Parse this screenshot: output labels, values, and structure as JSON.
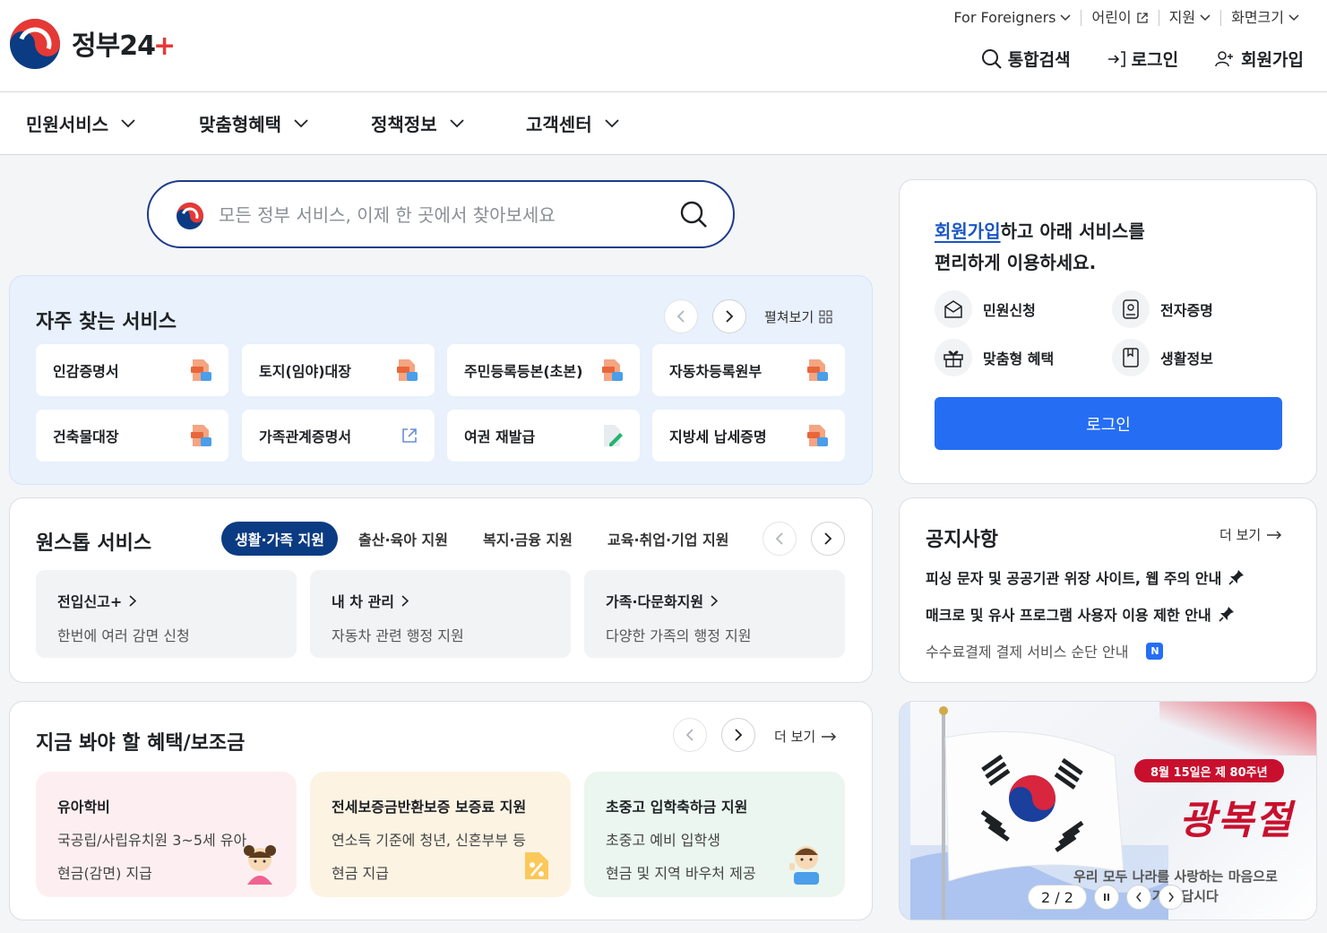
{
  "header": {
    "logo_text": "정부24",
    "utility": [
      {
        "label": "For Foreigners"
      },
      {
        "label": "어린이"
      },
      {
        "label": "지원"
      },
      {
        "label": "화면크기"
      }
    ],
    "actions": {
      "search": "통합검색",
      "login": "로그인",
      "signup": "회원가입"
    }
  },
  "gnb": [
    {
      "label": "민원서비스"
    },
    {
      "label": "맞춤형혜택"
    },
    {
      "label": "정책정보"
    },
    {
      "label": "고객센터"
    }
  ],
  "search": {
    "placeholder": "모든 정부 서비스, 이제 한 곳에서 찾아보세요"
  },
  "frequent": {
    "title": "자주 찾는 서비스",
    "expand": "펼쳐보기",
    "items": [
      {
        "label": "인감증명서",
        "icon": "pdf-doc-icon"
      },
      {
        "label": "토지(임야)대장",
        "icon": "pdf-doc-icon"
      },
      {
        "label": "주민등록등본(초본)",
        "icon": "pdf-doc-icon"
      },
      {
        "label": "자동차등록원부",
        "icon": "pdf-doc-icon"
      },
      {
        "label": "건축물대장",
        "icon": "pdf-doc-icon"
      },
      {
        "label": "가족관계증명서",
        "icon": "external-link-icon"
      },
      {
        "label": "여권 재발급",
        "icon": "edit-doc-icon"
      },
      {
        "label": "지방세 납세증명",
        "icon": "pdf-doc-icon"
      }
    ]
  },
  "onestop": {
    "title": "원스톱 서비스",
    "tabs": [
      "생활·가족 지원",
      "출산·육아 지원",
      "복지·금융 지원",
      "교육·취업·기업 지원"
    ],
    "cards": [
      {
        "title": "전입신고+",
        "sub": "한번에 여러 감면 신청"
      },
      {
        "title": "내 차 관리",
        "sub": "자동차 관련 행정 지원"
      },
      {
        "title": "가족·다문화지원",
        "sub": "다양한 가족의 행정 지원"
      }
    ]
  },
  "benefits": {
    "title": "지금 봐야 할 혜택/보조금",
    "more": "더 보기",
    "cards": [
      {
        "title": "유아학비",
        "l1": "국공립/사립유치원 3~5세 유아",
        "l2": "현금(감면) 지급",
        "bg": "#fdeff1"
      },
      {
        "title": "전세보증금반환보증 보증료 지원",
        "l1": "연소득 기준에 청년, 신혼부부 등",
        "l2": "현금 지급",
        "bg": "#fdf3e3"
      },
      {
        "title": "초중고 입학축하금 지원",
        "l1": "초중고 예비 입학생",
        "l2": "현금 및 지역 바우처 제공",
        "bg": "#eaf6ef"
      }
    ]
  },
  "login_panel": {
    "highlight": "회원가입",
    "line1_rest": "하고 아래 서비스를",
    "line2": "편리하게 이용하세요.",
    "items": [
      {
        "label": "민원신청",
        "icon": "mail-doc-icon"
      },
      {
        "label": "전자증명",
        "icon": "id-card-icon"
      },
      {
        "label": "맞춤형 혜택",
        "icon": "gift-icon"
      },
      {
        "label": "생활정보",
        "icon": "bookmark-icon"
      }
    ],
    "button": "로그인"
  },
  "notice": {
    "title": "공지사항",
    "more": "더 보기",
    "items": [
      {
        "text": "피싱 문자 및 공공기관 위장 사이트, 웹 주의 안내",
        "pinned": true
      },
      {
        "text": "매크로 및 유사 프로그램 사용자 이용 제한 안내",
        "pinned": true
      },
      {
        "text": "수수료결제 결제 서비스 순단 안내",
        "badge": "N"
      }
    ]
  },
  "banner": {
    "tag": "8월 15일은 제 80주년",
    "title": "광복절",
    "sub1": "우리 모두 나라를 사랑하는 마음으로",
    "sub2": "태극기를 답시다",
    "pager": "2 / 2"
  },
  "colors": {
    "primary": "#256ef4",
    "navy": "#0b3b82",
    "accent_red": "#c8102e",
    "freq_bg": "#e8f1fc"
  }
}
